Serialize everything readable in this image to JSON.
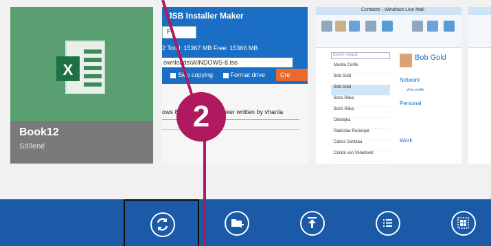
{
  "excel": {
    "name": "Book12",
    "subtitle": "Sdílené",
    "logo_letter": "X"
  },
  "usb": {
    "title": "JSB Installer Maker",
    "drive": "F",
    "total": "2 Total: 15367 MB Free: 15366 MB",
    "path": "ownloads\\WINDOWS-8.iso",
    "opt_copy": "Skip copying",
    "opt_format": "Format drive",
    "create": "Cre",
    "footer": "ows 8 USB Installer Maker written by vhanla"
  },
  "contacts": {
    "title": "Contacts - Windows Live Mail",
    "search_placeholder": "Search contacts",
    "list": [
      "Marika Čertik",
      "Bob Gold",
      "Bob Gold",
      "Boris Ráka",
      "Boris Ráka",
      "Ondrejka",
      "Radoslav Reisinger",
      "Carlos Santana",
      "Conda von Vonebond"
    ],
    "name": "Bob Gold",
    "section_network": "Network",
    "view_profile": "View profile",
    "section_personal": "Personal",
    "section_work": "Work"
  },
  "appbar": {
    "buttons": [
      {
        "name": "sync-icon",
        "selected": true
      },
      {
        "name": "new-folder-icon",
        "selected": false
      },
      {
        "name": "upload-icon",
        "selected": false
      },
      {
        "name": "list-view-icon",
        "selected": false
      },
      {
        "name": "select-all-icon",
        "selected": false
      }
    ]
  },
  "callout": {
    "label": "2"
  },
  "colors": {
    "appbar": "#1b5aa6",
    "excel_green": "#5a9f71",
    "callout": "#b0195f"
  }
}
